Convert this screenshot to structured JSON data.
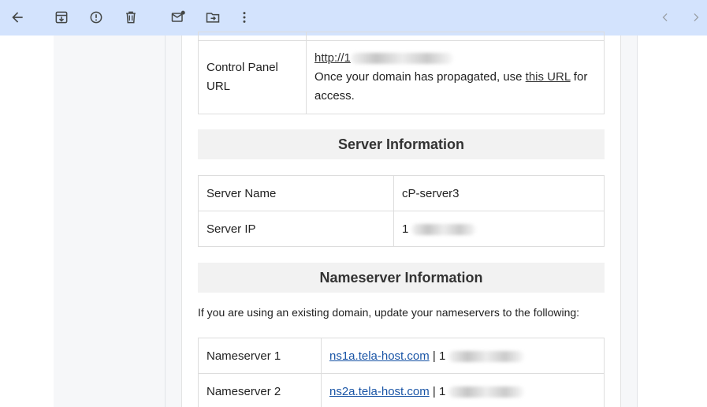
{
  "toolbar": {
    "icons": [
      "back-arrow-icon",
      "archive-icon",
      "report-spam-icon",
      "delete-icon",
      "mark-unread-icon",
      "move-to-icon",
      "more-options-icon",
      "newer-icon",
      "older-icon"
    ]
  },
  "control_panel": {
    "label_line1": "Control Panel",
    "label_line2": "URL",
    "url_text": "http://1",
    "note_before": "Once your domain has propagated, use ",
    "note_link": "this URL",
    "note_after": " for access."
  },
  "server_info": {
    "heading": "Server Information",
    "rows": [
      {
        "label": "Server Name",
        "value": "cP-server3"
      },
      {
        "label": "Server IP",
        "value": "1"
      }
    ]
  },
  "nameserver_info": {
    "heading": "Nameserver Information",
    "intro": "If you are using an existing domain, update your nameservers to the following:",
    "rows": [
      {
        "label": "Nameserver 1",
        "host": "ns1a.tela-host.com",
        "sep": " | ",
        "ip": "1"
      },
      {
        "label": "Nameserver 2",
        "host": "ns2a.tela-host.com",
        "sep": " | ",
        "ip": "1"
      }
    ]
  },
  "colors": {
    "toolbar_bg": "#d3e3fd",
    "link": "#1a55a6",
    "section_bg": "#f2f2f2"
  }
}
